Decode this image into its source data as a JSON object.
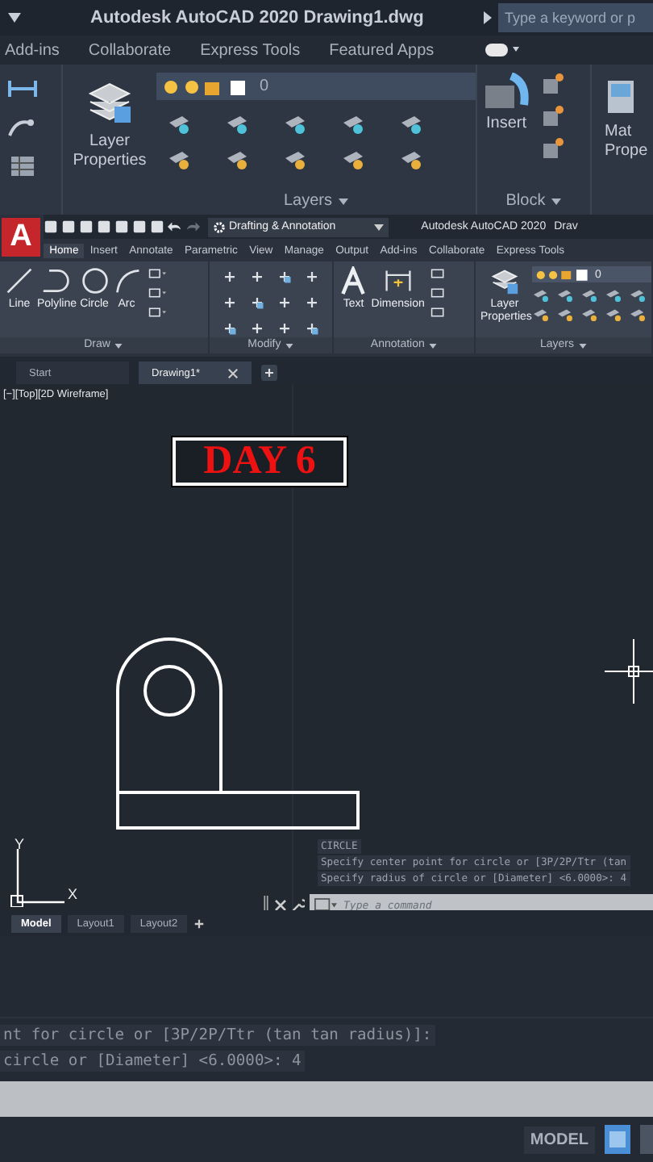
{
  "zoom_top": {
    "title": "Autodesk AutoCAD 2020   Drawing1.dwg",
    "search": {
      "placeholder": "Type a keyword or p"
    },
    "tabs": [
      "Add-ins",
      "Collaborate",
      "Express Tools",
      "Featured Apps"
    ],
    "layer_combo": "0",
    "layer_button": "Layer Properties",
    "panels": [
      "Layers",
      "Block"
    ],
    "insert": "Insert",
    "cut_button": [
      "Mat",
      "Prope"
    ]
  },
  "app_logo": "A",
  "workspace": "Drafting & Annotation",
  "app_title": "Autodesk AutoCAD 2020",
  "app_title_cut": "Drav",
  "ribbon_tabs": [
    {
      "label": "Home",
      "selected": true
    },
    {
      "label": "Insert",
      "selected": false
    },
    {
      "label": "Annotate",
      "selected": false
    },
    {
      "label": "Parametric",
      "selected": false
    },
    {
      "label": "View",
      "selected": false
    },
    {
      "label": "Manage",
      "selected": false
    },
    {
      "label": "Output",
      "selected": false
    },
    {
      "label": "Add-ins",
      "selected": false
    },
    {
      "label": "Collaborate",
      "selected": false
    },
    {
      "label": "Express Tools",
      "selected": false
    }
  ],
  "panels": [
    {
      "kind": "draw",
      "label": "Draw",
      "tools": [
        "Line",
        "Polyline",
        "Circle",
        "Arc"
      ]
    },
    {
      "kind": "modify",
      "label": "Modify"
    },
    {
      "kind": "annotation",
      "label": "Annotation",
      "tools": [
        "Text",
        "Dimension"
      ]
    },
    {
      "kind": "layers",
      "label": "Layers",
      "tools": [
        "Layer Properties"
      ],
      "combo": "0"
    }
  ],
  "file_tabs": [
    {
      "label": "Start",
      "selected": false
    },
    {
      "label": "Drawing1*",
      "selected": true
    }
  ],
  "viewport_label": "[−][Top][2D Wireframe]",
  "banner": "DAY 6",
  "ucs": {
    "y": "Y",
    "x": "X"
  },
  "command_history": [
    "CIRCLE",
    "Specify center point for circle or [3P/2P/Ttr (tan",
    "Specify radius of circle or [Diameter] <6.0000>: 4"
  ],
  "command_line": {
    "placeholder": "Type a command"
  },
  "layout_tabs": [
    {
      "label": "Model",
      "selected": true
    },
    {
      "label": "Layout1",
      "selected": false
    },
    {
      "label": "Layout2",
      "selected": false
    }
  ],
  "zoom_bottom": {
    "history": [
      "nt for circle or [3P/2P/Ttr (tan tan radius)]:",
      "circle or [Diameter] <6.0000>: 4"
    ],
    "status": "MODEL"
  }
}
